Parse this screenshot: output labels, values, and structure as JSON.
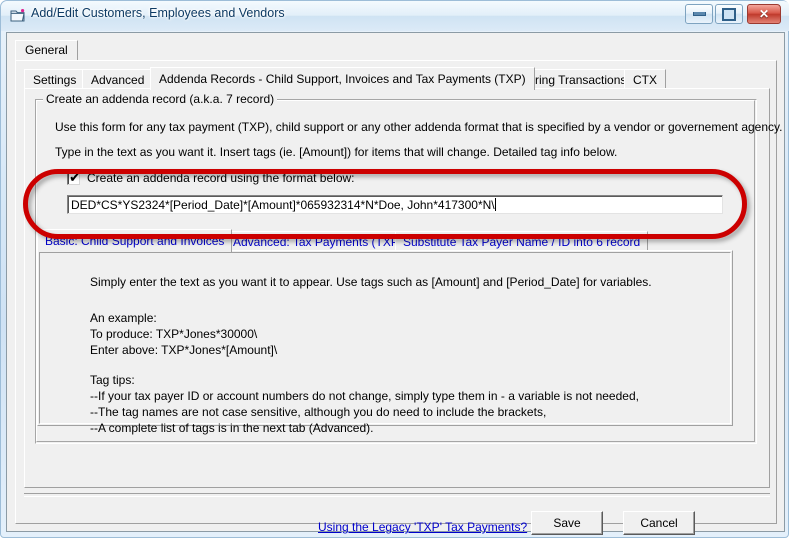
{
  "window": {
    "title": "Add/Edit Customers, Employees and Vendors",
    "icon": "customers-window-icon",
    "controls": {
      "minimize": "Minimize",
      "maximize": "Maximize",
      "close": "✕"
    },
    "accent_red": "#cc0000",
    "link_blue": "#0000cc"
  },
  "outer_tabs": [
    {
      "label": "General",
      "active": true
    }
  ],
  "inner_tabs": [
    {
      "label": "Settings",
      "active": false
    },
    {
      "label": "Advanced",
      "active": false
    },
    {
      "label": "Addenda Records - Child Support, Invoices and Tax Payments (TXP)",
      "active": true
    },
    {
      "label": "Recurring Transactions",
      "active": false
    },
    {
      "label": "CTX",
      "active": false
    }
  ],
  "groupbox": {
    "title": "Create an addenda record (a.k.a. 7 record)",
    "line1": "Use this form for any tax payment (TXP), child support or any other addenda format that is specified by a vendor or governement agency.",
    "line2": "Type in the text as you want it.  Insert tags (ie. [Amount]) for items that will change. Detailed tag info below."
  },
  "format_section": {
    "checkbox_label": "Create an addenda record using the format below:",
    "checkbox_checked": true,
    "checkbox_glyph": "✔",
    "input_value": "DED*CS*YS2324*[Period_Date]*[Amount]*065932314*N*Doe, John*417300*N\\",
    "input_placeholder": ""
  },
  "sub_tabs": [
    {
      "label": "Basic: Child Support and Invoices",
      "active": true
    },
    {
      "label": "Advanced: Tax Payments (TXP)",
      "active": false
    },
    {
      "label": "Substitute Tax Payer Name / ID into 6 record",
      "active": false
    }
  ],
  "help_panel": {
    "intro": "Simply enter the text as you want it to appear.  Use tags such as [Amount] and [Period_Date] for variables.",
    "example_heading": "An example:",
    "example_produce": "To produce: TXP*Jones*30000\\",
    "example_enter": "Enter above: TXP*Jones*[Amount]\\",
    "tips_heading": "Tag tips:",
    "tip1": "--If your tax payer ID or account numbers do not change, simply type them in - a variable is not needed,",
    "tip2": "--The tag names are not case sensitive, although you do need to include the brackets,",
    "tip3": "--A complete list of tags is in the next tab (Advanced)."
  },
  "footer": {
    "legacy_link": "Using the Legacy 'TXP' Tax Payments?",
    "save_label": "Save",
    "cancel_label": "Cancel"
  }
}
